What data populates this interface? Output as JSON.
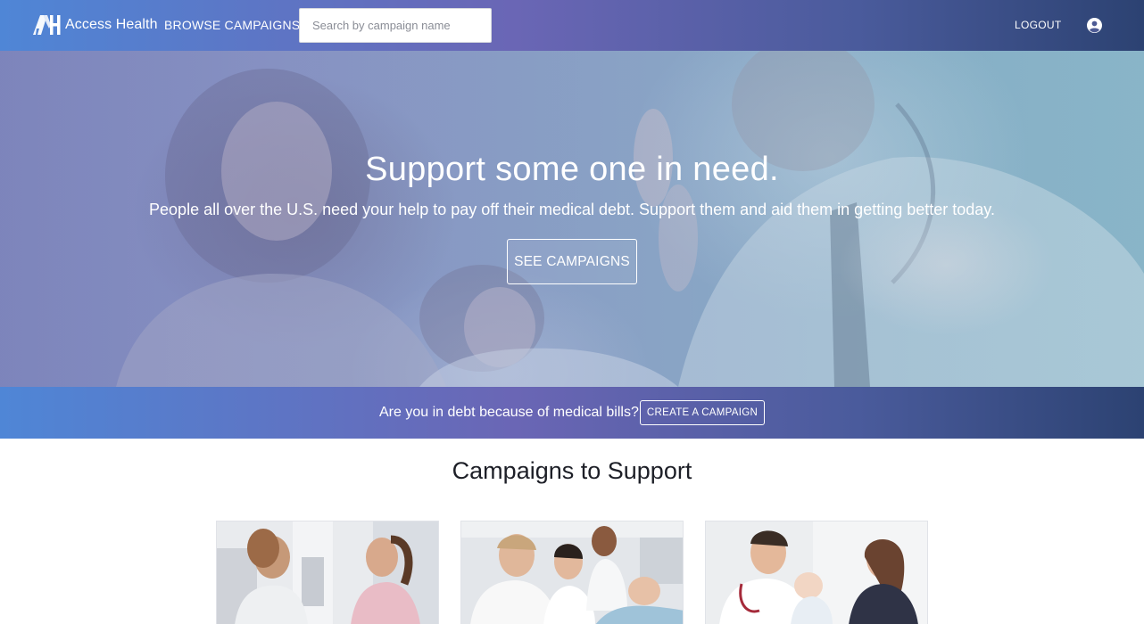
{
  "header": {
    "brand_name": "Access Health",
    "brand_mark": "AH",
    "nav_browse": "BROWSE CAMPAIGNS",
    "search_placeholder": "Search by campaign name",
    "search_value": "",
    "logout": "LOGOUT",
    "account_icon": "user-circle-icon"
  },
  "hero": {
    "title": "Support some one in need.",
    "subtitle": "People all over the U.S. need your help to pay off their medical debt. Support them and aid them in getting better today.",
    "button": "SEE CAMPAIGNS"
  },
  "cta": {
    "text": "Are you in debt because of medical bills?",
    "button": "CREATE A CAMPAIGN"
  },
  "campaigns": {
    "title": "Campaigns to Support",
    "cards": [
      {
        "image": "mammography-patient-photo"
      },
      {
        "image": "hospital-bedside-visit-photo"
      },
      {
        "image": "doctor-with-baby-photo"
      }
    ]
  },
  "colors": {
    "gradient_start": "#4f86d6",
    "gradient_mid": "#6a66b5",
    "gradient_end": "#2c4272"
  }
}
